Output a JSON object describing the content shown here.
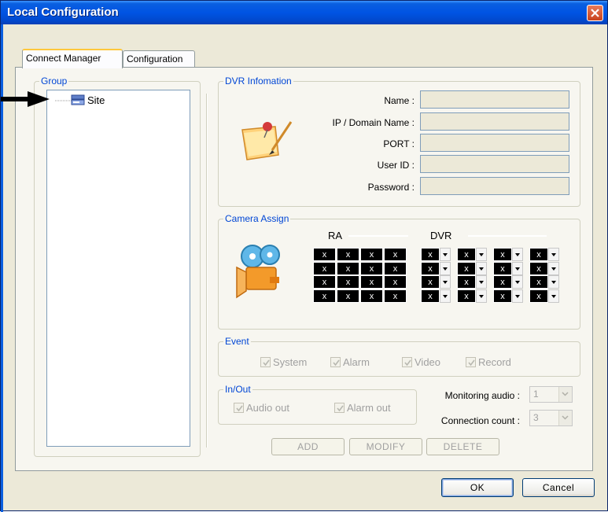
{
  "window": {
    "title": "Local Configuration"
  },
  "tabs": [
    "Connect Manager",
    "Configuration"
  ],
  "group": {
    "legend": "Group",
    "tree": [
      {
        "label": "Site"
      }
    ]
  },
  "dvr_info": {
    "legend": "DVR Infomation",
    "fields": [
      {
        "label": "Name :",
        "value": ""
      },
      {
        "label": "IP / Domain Name :",
        "value": ""
      },
      {
        "label": "PORT :",
        "value": ""
      },
      {
        "label": "User ID :",
        "value": ""
      },
      {
        "label": "Password :",
        "value": ""
      }
    ]
  },
  "camera_assign": {
    "legend": "Camera Assign",
    "ra_header": "RA",
    "dvr_header": "DVR",
    "cell_mark": "x",
    "rows": 4,
    "ra_cols": 4,
    "dvr_cols": 4
  },
  "event": {
    "legend": "Event",
    "options": [
      {
        "label": "System",
        "checked": true
      },
      {
        "label": "Alarm",
        "checked": true
      },
      {
        "label": "Video",
        "checked": true
      },
      {
        "label": "Record",
        "checked": true
      }
    ]
  },
  "inout": {
    "legend": "In/Out",
    "options": [
      {
        "label": "Audio out",
        "checked": true
      },
      {
        "label": "Alarm out",
        "checked": true
      }
    ]
  },
  "monitoring_audio": {
    "label": "Monitoring audio :",
    "value": "1"
  },
  "connection_count": {
    "label": "Connection count :",
    "value": "3"
  },
  "actions": {
    "add": "ADD",
    "modify": "MODIFY",
    "delete": "DELETE"
  },
  "dialog": {
    "ok": "OK",
    "cancel": "Cancel"
  },
  "colors": {
    "title_bar": "#0054e3",
    "legend_text": "#0046d5",
    "dialog_bg": "#ece9d8"
  }
}
